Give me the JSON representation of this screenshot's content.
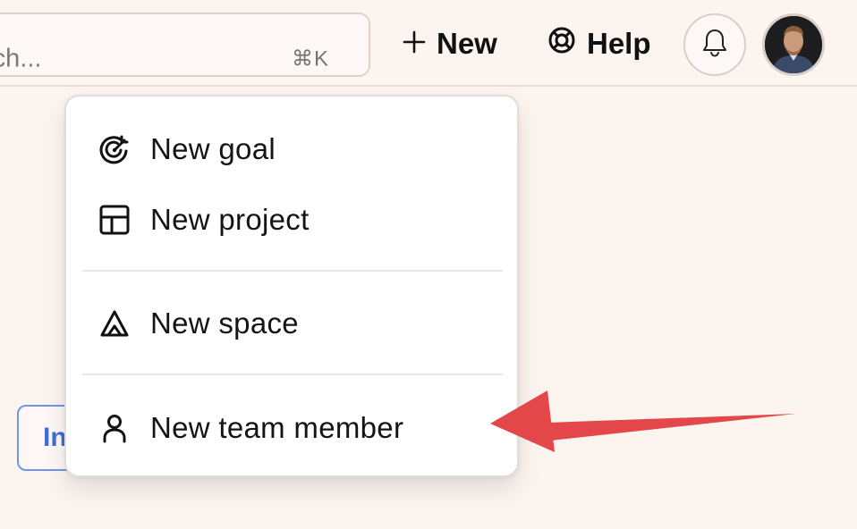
{
  "header": {
    "search": {
      "placeholder": "Search...",
      "visible_text": "rch...",
      "shortcut": "⌘K"
    },
    "new_label": "New",
    "help_label": "Help",
    "bell_icon": "bell-icon",
    "avatar_icon": "user-avatar"
  },
  "background_button": {
    "label": "In"
  },
  "menu": {
    "items": [
      {
        "label": "New goal",
        "icon": "target-icon"
      },
      {
        "label": "New project",
        "icon": "grid-icon"
      },
      {
        "label": "New space",
        "icon": "tent-icon"
      },
      {
        "label": "New team member",
        "icon": "person-icon"
      }
    ]
  },
  "annotation": {
    "arrow_color": "#e4474a"
  },
  "colors": {
    "background": "#fcf4ef",
    "accent": "#3f6ed8"
  }
}
